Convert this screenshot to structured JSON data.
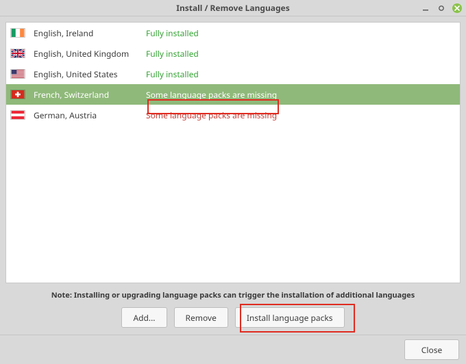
{
  "window": {
    "title": "Install / Remove Languages"
  },
  "languages": [
    {
      "name": "English, Ireland",
      "status": "Fully installed",
      "missing": false,
      "selected": false,
      "flag": "ireland"
    },
    {
      "name": "English, United Kingdom",
      "status": "Fully installed",
      "missing": false,
      "selected": false,
      "flag": "uk"
    },
    {
      "name": "English, United States",
      "status": "Fully installed",
      "missing": false,
      "selected": false,
      "flag": "us"
    },
    {
      "name": "French, Switzerland",
      "status": "Some language packs are missing",
      "missing": true,
      "selected": true,
      "flag": "switzerland"
    },
    {
      "name": "German, Austria",
      "status": "Some language packs are missing",
      "missing": true,
      "selected": false,
      "flag": "austria"
    }
  ],
  "note": "Note: Installing or upgrading language packs can trigger the installation of additional languages",
  "buttons": {
    "add": "Add...",
    "remove": "Remove",
    "install": "Install language packs",
    "close": "Close"
  }
}
